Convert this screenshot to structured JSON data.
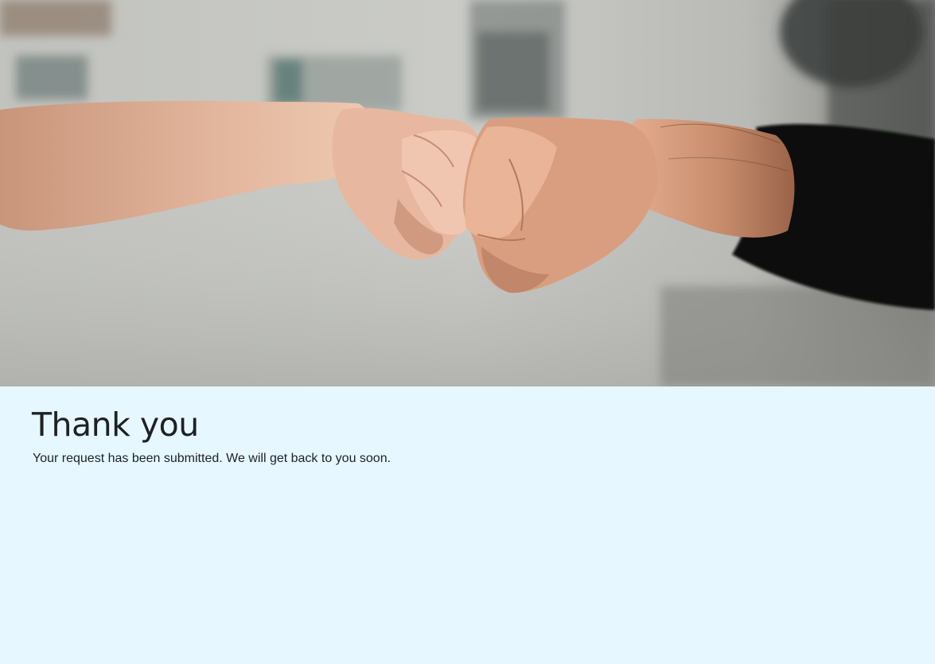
{
  "hero": {
    "image_icon": "fist-bump-photo"
  },
  "confirmation": {
    "title": "Thank you",
    "message": "Your request has been submitted. We will get back to you soon."
  },
  "colors": {
    "content_background": "#e6f7ff",
    "text": "#1d2126"
  }
}
